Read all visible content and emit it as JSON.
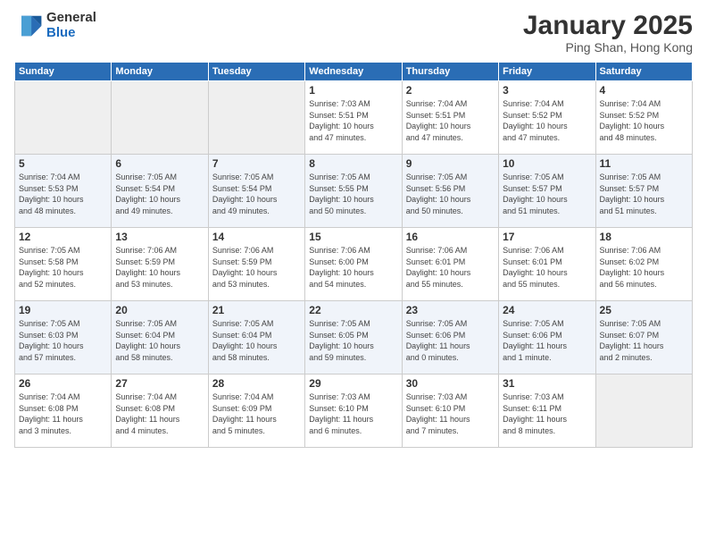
{
  "logo": {
    "general": "General",
    "blue": "Blue"
  },
  "header": {
    "title": "January 2025",
    "subtitle": "Ping Shan, Hong Kong"
  },
  "weekdays": [
    "Sunday",
    "Monday",
    "Tuesday",
    "Wednesday",
    "Thursday",
    "Friday",
    "Saturday"
  ],
  "weeks": [
    [
      {
        "day": "",
        "info": ""
      },
      {
        "day": "",
        "info": ""
      },
      {
        "day": "",
        "info": ""
      },
      {
        "day": "1",
        "info": "Sunrise: 7:03 AM\nSunset: 5:51 PM\nDaylight: 10 hours\nand 47 minutes."
      },
      {
        "day": "2",
        "info": "Sunrise: 7:04 AM\nSunset: 5:51 PM\nDaylight: 10 hours\nand 47 minutes."
      },
      {
        "day": "3",
        "info": "Sunrise: 7:04 AM\nSunset: 5:52 PM\nDaylight: 10 hours\nand 47 minutes."
      },
      {
        "day": "4",
        "info": "Sunrise: 7:04 AM\nSunset: 5:52 PM\nDaylight: 10 hours\nand 48 minutes."
      }
    ],
    [
      {
        "day": "5",
        "info": "Sunrise: 7:04 AM\nSunset: 5:53 PM\nDaylight: 10 hours\nand 48 minutes."
      },
      {
        "day": "6",
        "info": "Sunrise: 7:05 AM\nSunset: 5:54 PM\nDaylight: 10 hours\nand 49 minutes."
      },
      {
        "day": "7",
        "info": "Sunrise: 7:05 AM\nSunset: 5:54 PM\nDaylight: 10 hours\nand 49 minutes."
      },
      {
        "day": "8",
        "info": "Sunrise: 7:05 AM\nSunset: 5:55 PM\nDaylight: 10 hours\nand 50 minutes."
      },
      {
        "day": "9",
        "info": "Sunrise: 7:05 AM\nSunset: 5:56 PM\nDaylight: 10 hours\nand 50 minutes."
      },
      {
        "day": "10",
        "info": "Sunrise: 7:05 AM\nSunset: 5:57 PM\nDaylight: 10 hours\nand 51 minutes."
      },
      {
        "day": "11",
        "info": "Sunrise: 7:05 AM\nSunset: 5:57 PM\nDaylight: 10 hours\nand 51 minutes."
      }
    ],
    [
      {
        "day": "12",
        "info": "Sunrise: 7:05 AM\nSunset: 5:58 PM\nDaylight: 10 hours\nand 52 minutes."
      },
      {
        "day": "13",
        "info": "Sunrise: 7:06 AM\nSunset: 5:59 PM\nDaylight: 10 hours\nand 53 minutes."
      },
      {
        "day": "14",
        "info": "Sunrise: 7:06 AM\nSunset: 5:59 PM\nDaylight: 10 hours\nand 53 minutes."
      },
      {
        "day": "15",
        "info": "Sunrise: 7:06 AM\nSunset: 6:00 PM\nDaylight: 10 hours\nand 54 minutes."
      },
      {
        "day": "16",
        "info": "Sunrise: 7:06 AM\nSunset: 6:01 PM\nDaylight: 10 hours\nand 55 minutes."
      },
      {
        "day": "17",
        "info": "Sunrise: 7:06 AM\nSunset: 6:01 PM\nDaylight: 10 hours\nand 55 minutes."
      },
      {
        "day": "18",
        "info": "Sunrise: 7:06 AM\nSunset: 6:02 PM\nDaylight: 10 hours\nand 56 minutes."
      }
    ],
    [
      {
        "day": "19",
        "info": "Sunrise: 7:05 AM\nSunset: 6:03 PM\nDaylight: 10 hours\nand 57 minutes."
      },
      {
        "day": "20",
        "info": "Sunrise: 7:05 AM\nSunset: 6:04 PM\nDaylight: 10 hours\nand 58 minutes."
      },
      {
        "day": "21",
        "info": "Sunrise: 7:05 AM\nSunset: 6:04 PM\nDaylight: 10 hours\nand 58 minutes."
      },
      {
        "day": "22",
        "info": "Sunrise: 7:05 AM\nSunset: 6:05 PM\nDaylight: 10 hours\nand 59 minutes."
      },
      {
        "day": "23",
        "info": "Sunrise: 7:05 AM\nSunset: 6:06 PM\nDaylight: 11 hours\nand 0 minutes."
      },
      {
        "day": "24",
        "info": "Sunrise: 7:05 AM\nSunset: 6:06 PM\nDaylight: 11 hours\nand 1 minute."
      },
      {
        "day": "25",
        "info": "Sunrise: 7:05 AM\nSunset: 6:07 PM\nDaylight: 11 hours\nand 2 minutes."
      }
    ],
    [
      {
        "day": "26",
        "info": "Sunrise: 7:04 AM\nSunset: 6:08 PM\nDaylight: 11 hours\nand 3 minutes."
      },
      {
        "day": "27",
        "info": "Sunrise: 7:04 AM\nSunset: 6:08 PM\nDaylight: 11 hours\nand 4 minutes."
      },
      {
        "day": "28",
        "info": "Sunrise: 7:04 AM\nSunset: 6:09 PM\nDaylight: 11 hours\nand 5 minutes."
      },
      {
        "day": "29",
        "info": "Sunrise: 7:03 AM\nSunset: 6:10 PM\nDaylight: 11 hours\nand 6 minutes."
      },
      {
        "day": "30",
        "info": "Sunrise: 7:03 AM\nSunset: 6:10 PM\nDaylight: 11 hours\nand 7 minutes."
      },
      {
        "day": "31",
        "info": "Sunrise: 7:03 AM\nSunset: 6:11 PM\nDaylight: 11 hours\nand 8 minutes."
      },
      {
        "day": "",
        "info": ""
      }
    ]
  ]
}
